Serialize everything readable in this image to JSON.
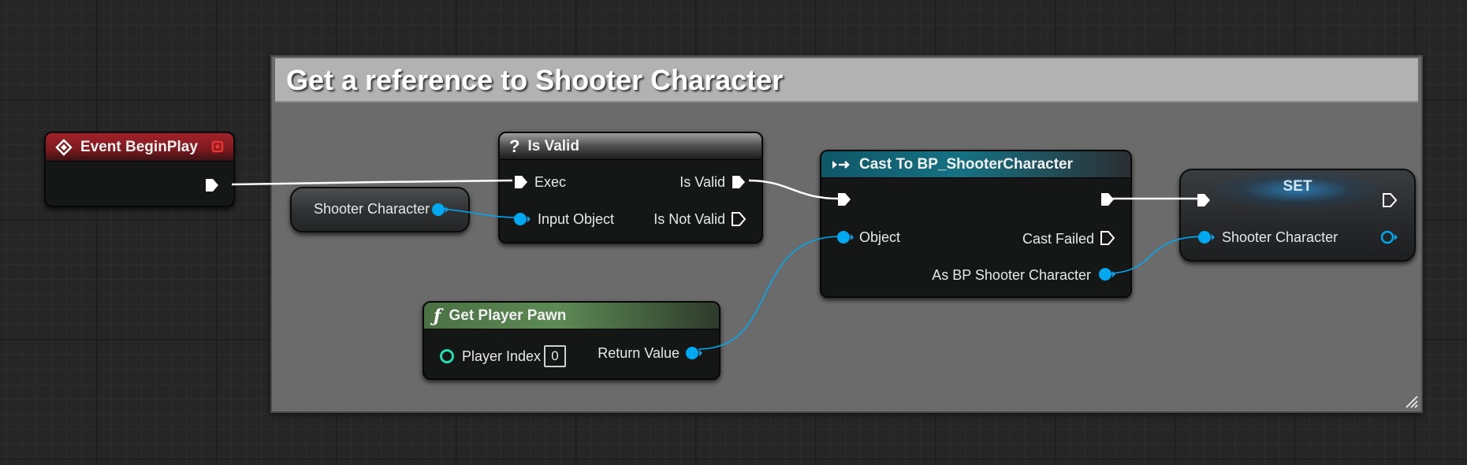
{
  "comment": {
    "title": "Get a reference to Shooter Character"
  },
  "nodes": {
    "event_begin_play": {
      "title": "Event BeginPlay"
    },
    "shooter_character_get": {
      "label": "Shooter Character"
    },
    "is_valid": {
      "title": "Is Valid",
      "exec_label": "Exec",
      "input_object_label": "Input Object",
      "is_valid_label": "Is Valid",
      "is_not_valid_label": "Is Not Valid"
    },
    "cast": {
      "title": "Cast To BP_ShooterCharacter",
      "object_label": "Object",
      "cast_failed_label": "Cast Failed",
      "as_label": "As BP Shooter Character"
    },
    "set": {
      "title": "SET",
      "var_label": "Shooter Character"
    },
    "get_player_pawn": {
      "title": "Get Player Pawn",
      "player_index_label": "Player Index",
      "player_index_value": "0",
      "return_value_label": "Return Value"
    }
  },
  "colors": {
    "exec_wire": "#ffffff",
    "object_pin": "#00a8f0",
    "int_pin": "#1fe0b0",
    "event_header": "#a3222a",
    "cast_header": "#157182",
    "pure_function_header": "#5d8a55"
  },
  "icons": {
    "event": "event-diamond-icon",
    "is_valid": "question-mark-icon",
    "cast": "cast-arrow-icon",
    "function": "function-f-icon",
    "delegate": "delegate-square-icon"
  }
}
